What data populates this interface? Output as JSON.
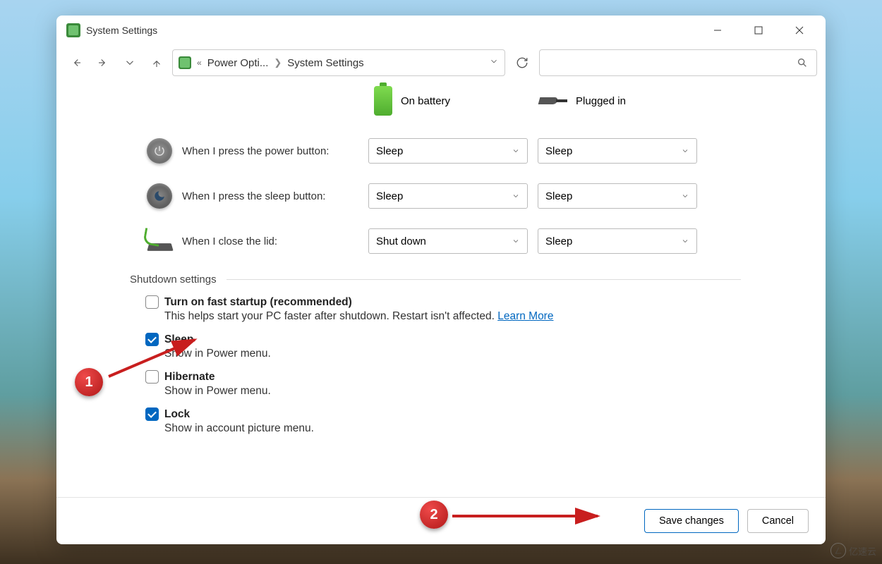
{
  "window": {
    "title": "System Settings"
  },
  "breadcrumb": {
    "parent": "Power Opti...",
    "current": "System Settings"
  },
  "columns": {
    "battery": "On battery",
    "plugged": "Plugged in"
  },
  "settings": [
    {
      "label": "When I press the power button:",
      "battery": "Sleep",
      "plugged": "Sleep"
    },
    {
      "label": "When I press the sleep button:",
      "battery": "Sleep",
      "plugged": "Sleep"
    },
    {
      "label": "When I close the lid:",
      "battery": "Shut down",
      "plugged": "Sleep"
    }
  ],
  "section": {
    "title": "Shutdown settings"
  },
  "checkboxes": [
    {
      "label": "Turn on fast startup (recommended)",
      "desc": "This helps start your PC faster after shutdown. Restart isn't affected.",
      "link": "Learn More",
      "checked": false
    },
    {
      "label": "Sleep",
      "desc": "Show in Power menu.",
      "checked": true
    },
    {
      "label": "Hibernate",
      "desc": "Show in Power menu.",
      "checked": false
    },
    {
      "label": "Lock",
      "desc": "Show in account picture menu.",
      "checked": true
    }
  ],
  "buttons": {
    "save": "Save changes",
    "cancel": "Cancel"
  },
  "annotations": {
    "step1": "1",
    "step2": "2"
  },
  "watermark": "亿速云"
}
